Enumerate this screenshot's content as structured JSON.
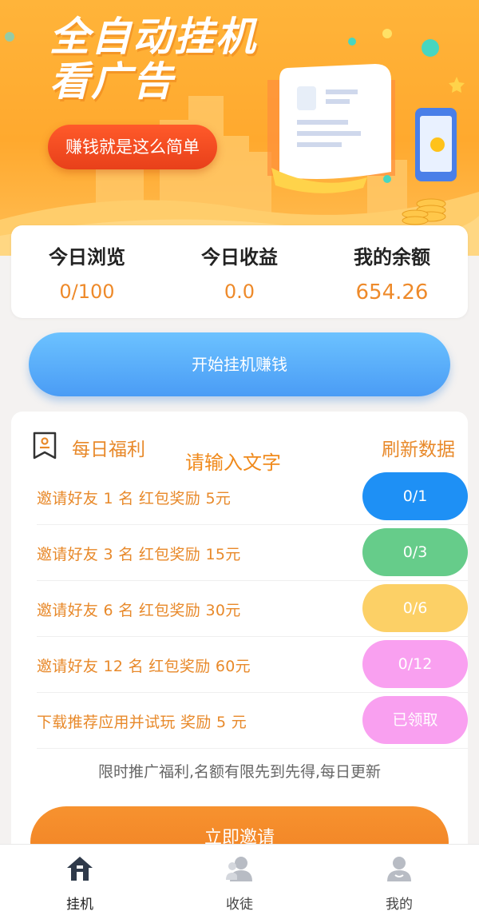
{
  "banner": {
    "title": "全自动挂机\n看广告",
    "pill_label": "赚钱就是这么简单"
  },
  "stats": [
    {
      "label": "今日浏览",
      "value": "0/100"
    },
    {
      "label": "今日收益",
      "value": "0.0"
    },
    {
      "label": "我的余额",
      "value": "654.26"
    }
  ],
  "start_button": "开始挂机赚钱",
  "daily": {
    "title": "每日福利",
    "placeholder_text": "请输入文字",
    "refresh": "刷新数据",
    "tasks": [
      {
        "label": "邀请好友 1 名 红包奖励 5元",
        "status": "0/1",
        "color": "#1e90f5"
      },
      {
        "label": "邀请好友 3 名 红包奖励 15元",
        "status": "0/3",
        "color": "#66cc8a"
      },
      {
        "label": "邀请好友 6 名 红包奖励 30元",
        "status": "0/6",
        "color": "#fcd066"
      },
      {
        "label": "邀请好友 12 名 红包奖励 60元",
        "status": "0/12",
        "color": "#f9a0f0"
      },
      {
        "label": "下载推荐应用并试玩 奖励 5 元",
        "status": "已领取",
        "color": "#f9a0f0"
      }
    ],
    "notice": "限时推广福利,名额有限先到先得,每日更新",
    "invite_button": "立即邀请"
  },
  "nav": [
    {
      "label": "挂机",
      "icon": "home-icon",
      "active": true
    },
    {
      "label": "收徒",
      "icon": "apprentice-icon",
      "active": false
    },
    {
      "label": "我的",
      "icon": "profile-icon",
      "active": false
    }
  ],
  "colors": {
    "accent_orange": "#e8892a",
    "banner_orange": "#ffa92e",
    "start_blue": "#4a9cf5",
    "invite_orange": "#ef7f22"
  }
}
